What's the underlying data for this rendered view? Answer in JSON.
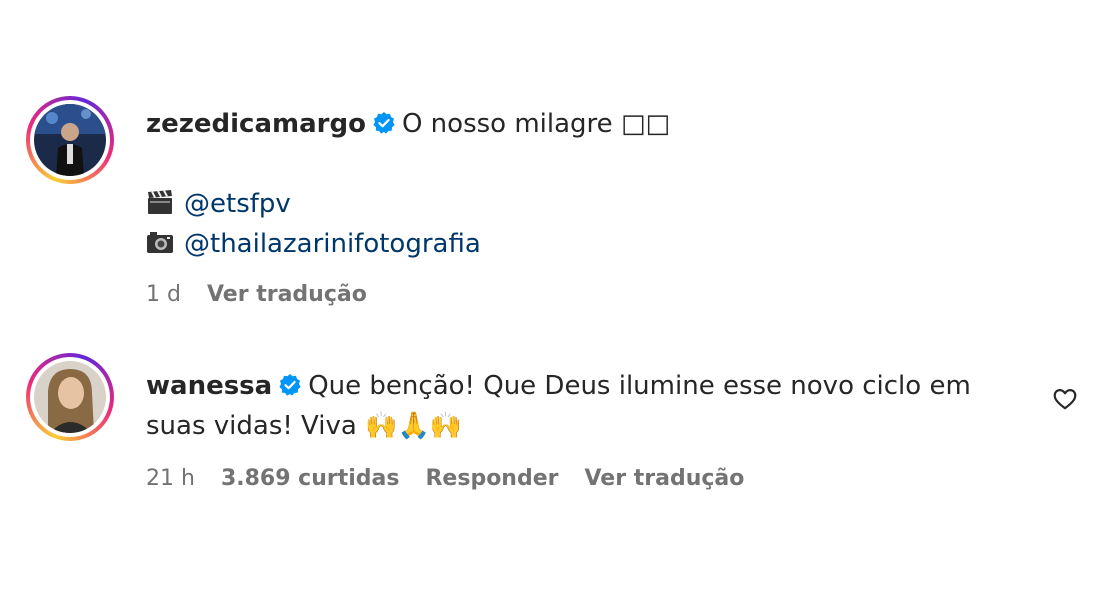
{
  "comments": [
    {
      "username": "zezedicamargo",
      "text": "O nosso milagre",
      "text_suffix": "□□",
      "credits": [
        {
          "icon": "clapper-board-icon",
          "handle": "@etsfpv"
        },
        {
          "icon": "camera-icon",
          "handle": "@thailazarinifotografia"
        }
      ],
      "time": "1 d",
      "translate_label": "Ver tradução"
    },
    {
      "username": "wanessa",
      "text_line1": "Que benção! Que Deus ilumine esse novo ciclo em",
      "text_line2": "suas vidas! Viva",
      "emojis": "🙌🙏🙌",
      "time": "21 h",
      "likes": "3.869 curtidas",
      "reply_label": "Responder",
      "translate_label": "Ver tradução"
    }
  ],
  "colors": {
    "text": "#262626",
    "meta": "#737373",
    "link": "#00376b",
    "verified": "#0095f6"
  }
}
